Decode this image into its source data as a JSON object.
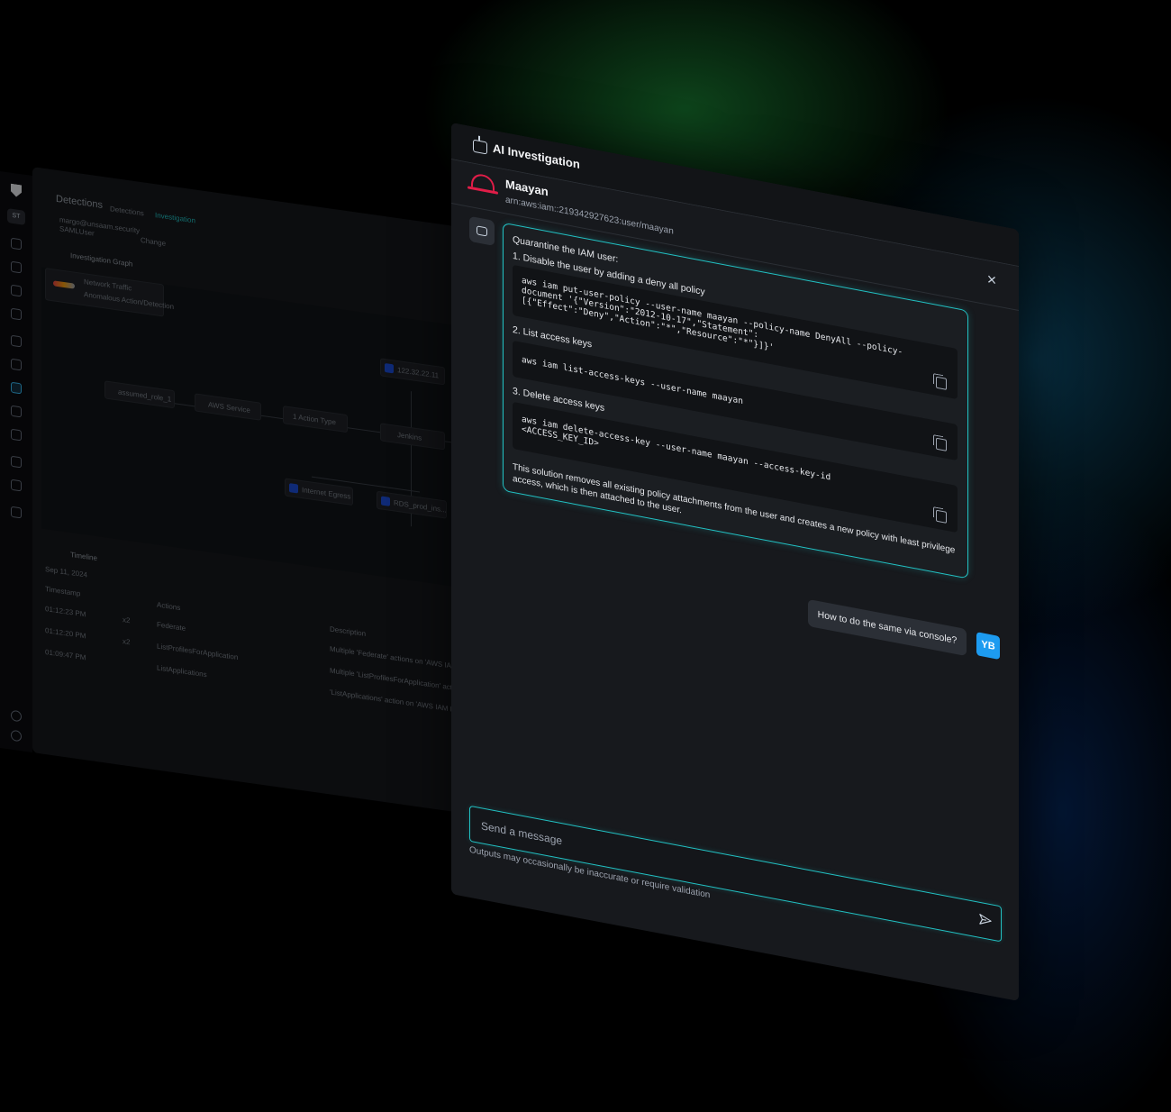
{
  "bg_app": {
    "sidebar": {
      "workspace": "ST"
    },
    "header": {
      "title": "Detections",
      "breadcrumbs": [
        "Detections",
        "Investigation"
      ]
    },
    "identity": {
      "email": "margo@unsaam.security",
      "type": "SAMLUser",
      "change_label": "Change"
    },
    "graph": {
      "title": "Investigation Graph",
      "legend": [
        "Network Traffic",
        "Anomalous Action/Detection"
      ],
      "nodes": [
        "122.32.22.11",
        "assumed_role_1",
        "AWS Service",
        "1 Action Type",
        "Jenkins",
        "Internet Egress",
        "RDS_prod_ins..."
      ]
    },
    "timeline": {
      "title": "Timeline",
      "date": "Sep 11, 2024",
      "columns": [
        "Timestamp",
        "Actions",
        "Description"
      ],
      "rows": [
        {
          "time": "01:12:23 PM",
          "count": "x2",
          "action": "Federate",
          "description": "Multiple 'Federate' actions on 'AWS IAM I"
        },
        {
          "time": "01:12:20 PM",
          "count": "x2",
          "action": "ListProfilesForApplication",
          "description": "Multiple 'ListProfilesForApplication' actio"
        },
        {
          "time": "01:09:47 PM",
          "count": "",
          "action": "ListApplications",
          "description": "'ListApplications' action on 'AWS IAM Ide"
        }
      ]
    }
  },
  "ai_panel": {
    "title": "AI Investigation",
    "user": {
      "name": "Maayan",
      "arn": "arn:aws:iam::219342927623:user/maayan"
    },
    "answer": {
      "heading": "Quarantine the IAM user:",
      "steps": [
        {
          "label": "1. Disable the user by adding a deny all policy",
          "code": "aws iam put-user-policy --user-name maayan --policy-name DenyAll --policy-\ndocument '{\"Version\":\"2012-10-17\",\"Statement\":\n[{\"Effect\":\"Deny\",\"Action\":\"*\",\"Resource\":\"*\"}]}'"
        },
        {
          "label": "2. List access keys",
          "code": "aws iam list-access-keys --user-name maayan"
        },
        {
          "label": "3. Delete access keys",
          "code": "aws iam delete-access-key --user-name maayan --access-key-id\n<ACCESS_KEY_ID>"
        }
      ],
      "summary": "This solution removes all existing policy attachments from the user and creates a new policy with least privilege access, which is then attached to the user."
    },
    "user_message": {
      "text": "How to do the same via console?",
      "avatar": "YB"
    },
    "input": {
      "placeholder": "Send a message",
      "value": ""
    },
    "disclaimer": "Outputs may occasionally be inaccurate or require validation"
  },
  "colors": {
    "accent_cyan": "#22c1c3",
    "user_avatar_blue": "#1d9bf0",
    "aws_red": "#e11d48",
    "panel_bg": "#17191d"
  },
  "icons": [
    "shield-logo-icon",
    "robot-icon",
    "aws-icon",
    "close-icon",
    "copy-icon",
    "send-icon"
  ]
}
